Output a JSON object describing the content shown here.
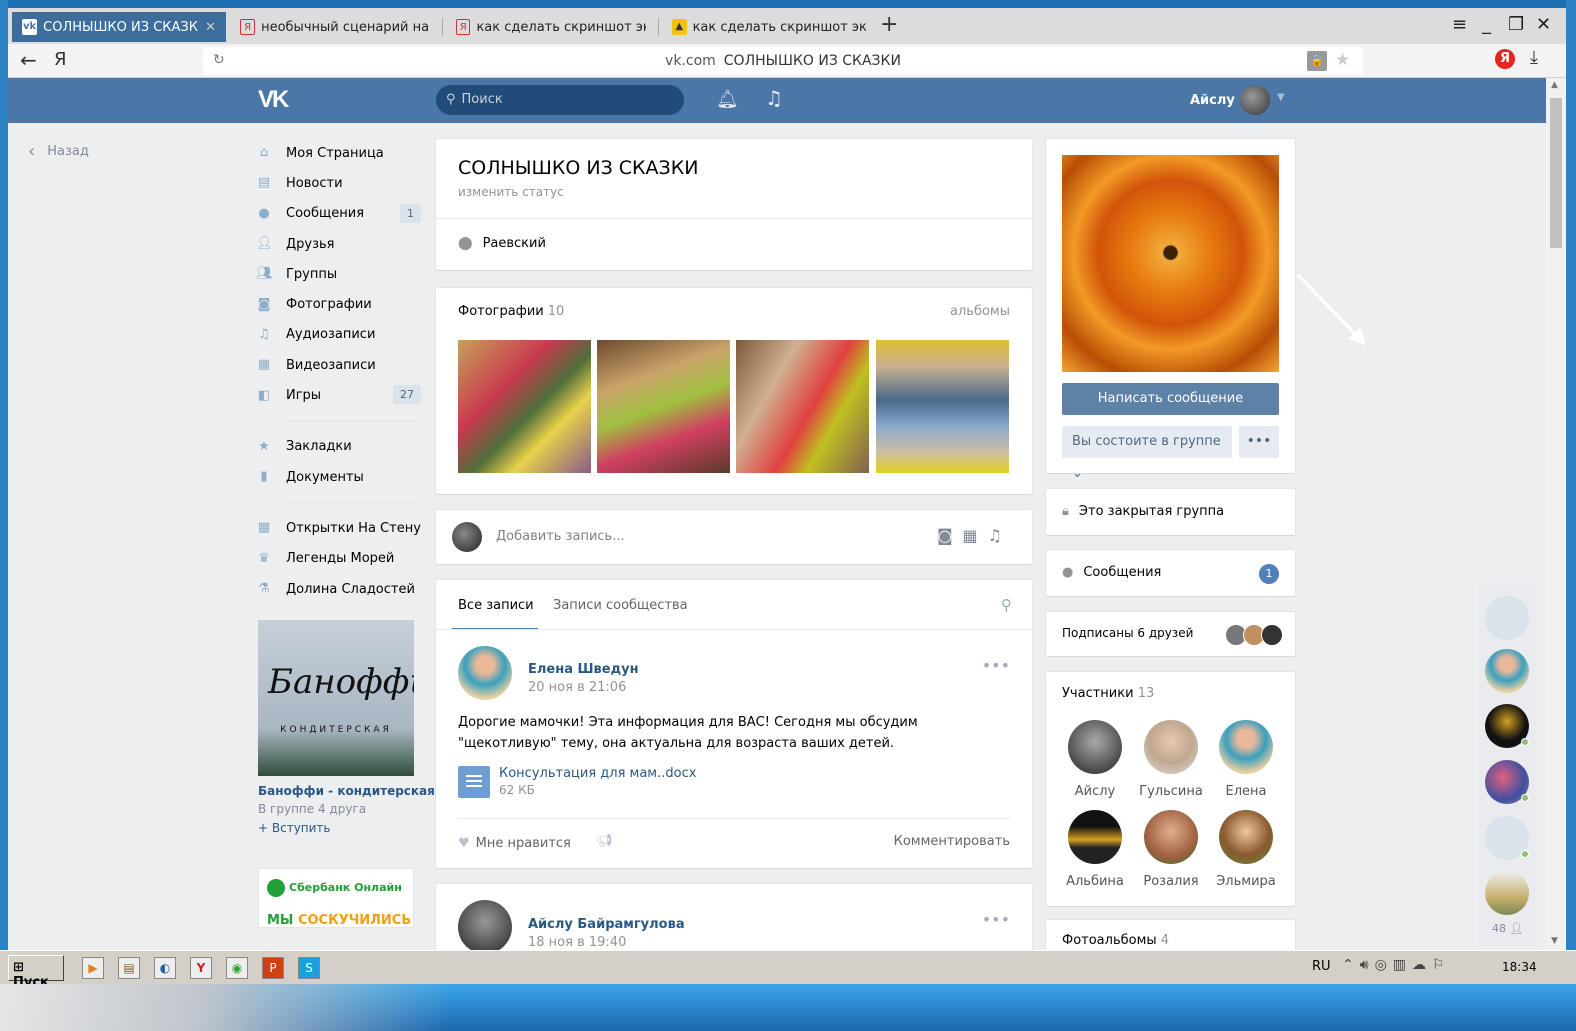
{
  "browser": {
    "tabs": [
      {
        "label": "СОЛНЫШКО ИЗ СКАЗКИ",
        "favicon": "vk-icon"
      },
      {
        "label": "необычный сценарий на н",
        "favicon": "yandex-icon"
      },
      {
        "label": "как сделать скриншот экра",
        "favicon": "yandex-icon"
      },
      {
        "label": "как сделать скриншот экра",
        "favicon": "image-search-icon"
      }
    ],
    "new_tab": "+",
    "address_domain": "vk.com",
    "address_title": "СОЛНЫШКО ИЗ СКАЗКИ",
    "back_glyph": "←",
    "yandex_glyph": "Я",
    "yandex_badge": "Я"
  },
  "vk_header": {
    "logo": "VK",
    "search_placeholder": "Поиск",
    "user_name": "Айслу"
  },
  "back_link": "Назад",
  "sidebar": {
    "items": [
      {
        "label": "Моя Страница",
        "icon": "home-icon"
      },
      {
        "label": "Новости",
        "icon": "news-icon"
      },
      {
        "label": "Сообщения",
        "icon": "messages-icon",
        "count": "1"
      },
      {
        "label": "Друзья",
        "icon": "friends-icon"
      },
      {
        "label": "Группы",
        "icon": "groups-icon"
      },
      {
        "label": "Фотографии",
        "icon": "camera-icon"
      },
      {
        "label": "Аудиозаписи",
        "icon": "music-icon"
      },
      {
        "label": "Видеозаписи",
        "icon": "film-icon"
      },
      {
        "label": "Игры",
        "icon": "gamepad-icon",
        "count": "27"
      }
    ],
    "items2": [
      {
        "label": "Закладки",
        "icon": "star-icon"
      },
      {
        "label": "Документы",
        "icon": "document-icon"
      }
    ],
    "items3": [
      {
        "label": "Открытки На Стену",
        "icon": "app-grid-icon"
      },
      {
        "label": "Легенды Морей",
        "icon": "crown-icon"
      },
      {
        "label": "Долина Сладостей",
        "icon": "flask-icon"
      }
    ]
  },
  "ad": {
    "logo_text": "Баноффи",
    "logo_sub": "КОНДИТЕРСКАЯ",
    "title": "Баноффи - кондитерская",
    "subtitle": "В группе 4 друга",
    "join": "+ Вступить"
  },
  "ad2": {
    "brand": "Сбербанк Онлайн",
    "msg_a": "МЫ",
    "msg_b": "СОСКУЧИЛИСЬ"
  },
  "group": {
    "title": "СОЛНЫШКО ИЗ СКАЗКИ",
    "status": "изменить статус",
    "place": "Раевский"
  },
  "photos": {
    "label": "Фотографии",
    "count": "10",
    "albums": "альбомы"
  },
  "composer": {
    "placeholder": "Добавить запись..."
  },
  "feed": {
    "tab_all": "Все записи",
    "tab_community": "Записи сообщества",
    "post1": {
      "author": "Елена Шведун",
      "date": "20 ноя в 21:06",
      "text": "Дорогие мамочки! Эта информация для ВАС! Сегодня мы обсудим \"щекотливую\" тему, она актуальна для возраста ваших детей.",
      "file_name": "Консультация для мам..docx",
      "file_size": "62 КБ",
      "like": "Мне нравится",
      "comment": "Комментировать"
    },
    "post2": {
      "author": "Айслу Байрамгулова",
      "date": "18 ноя в 19:40"
    }
  },
  "right": {
    "write_message": "Написать сообщение",
    "member_status": "Вы состоите в группе",
    "closed_group": "Это закрытая группа",
    "messages": "Сообщения",
    "messages_count": "1",
    "friends_subscribed": "Подписаны 6 друзей",
    "members_label": "Участники",
    "members_count": "13",
    "members": [
      "Айслу",
      "Гульсина",
      "Елена",
      "Альбина",
      "Розалия",
      "Эльмира"
    ],
    "albums_label": "Фотоальбомы",
    "albums_count": "4"
  },
  "chat": {
    "count": "48"
  },
  "taskbar": {
    "start": "Пуск",
    "lang": "RU",
    "clock": "18:34"
  },
  "colors": {
    "vk_blue": "#4a76a8",
    "link": "#2a5885",
    "bg": "#edeef0"
  }
}
